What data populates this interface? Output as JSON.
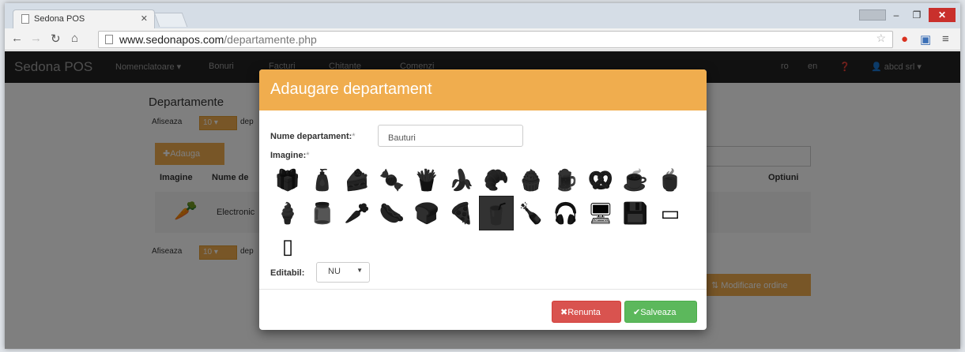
{
  "browser": {
    "tab_title": "Sedona POS",
    "url_host": "www.sedonapos.com",
    "url_path": "/departamente.php"
  },
  "navbar": {
    "brand": "Sedona POS",
    "menu": [
      "Nomenclatoare",
      "Bonuri",
      "Facturi",
      "Chitante",
      "Comenzi"
    ],
    "lang_ro": "ro",
    "lang_en": "en",
    "help_icon": "question-circle-icon",
    "user": "abcd srl"
  },
  "background_page": {
    "title": "Departamente",
    "show_label": "Afiseaza",
    "show_value": "10",
    "show_suffix": "dep",
    "add_button": "Adauga",
    "columns": [
      "Imagine",
      "Nume de",
      "Optiuni"
    ],
    "row_text": "Electronic",
    "bottom_show_label": "Afiseaza",
    "bottom_show_value": "10",
    "bottom_suffix": "dep",
    "order_button": "Modificare ordine"
  },
  "modal": {
    "title": "Adaugare departament",
    "name_label": "Nume departament:",
    "required_mark": "*",
    "name_value": "Bauturi",
    "image_label": "Imagine:",
    "icons": [
      {
        "name": "gift-box-icon",
        "glyph": "🎁"
      },
      {
        "name": "bottle-bag-icon",
        "glyph": "🧴"
      },
      {
        "name": "cake-slice-icon",
        "glyph": "🍰"
      },
      {
        "name": "candy-icon",
        "glyph": "🍬"
      },
      {
        "name": "fast-food-icon",
        "glyph": "🍟"
      },
      {
        "name": "banana-icon",
        "glyph": "🍌"
      },
      {
        "name": "croissant-icon",
        "glyph": "🥐"
      },
      {
        "name": "cupcake-icon",
        "glyph": "🧁"
      },
      {
        "name": "beer-mug-icon",
        "glyph": "🍺"
      },
      {
        "name": "pastry-icon",
        "glyph": "🥨"
      },
      {
        "name": "coffee-cup-icon",
        "glyph": "☕"
      },
      {
        "name": "tea-cup-icon",
        "glyph": "🍵"
      },
      {
        "name": "ice-cream-icon",
        "glyph": "🍦"
      },
      {
        "name": "jar-icon",
        "glyph": "🫙"
      },
      {
        "name": "carrot-icon",
        "glyph": "🥕"
      },
      {
        "name": "sausage-icon",
        "glyph": "🌭"
      },
      {
        "name": "bread-icon",
        "glyph": "🍞"
      },
      {
        "name": "pizza-icon",
        "glyph": "🍕"
      },
      {
        "name": "drink-cup-icon",
        "glyph": "🥤"
      },
      {
        "name": "wine-bottle-icon",
        "glyph": "🍾"
      },
      {
        "name": "headphones-icon",
        "glyph": "🎧"
      },
      {
        "name": "monitor-icon",
        "glyph": "🖥"
      },
      {
        "name": "disk-drive-icon",
        "glyph": "💾"
      },
      {
        "name": "tablet-icon",
        "glyph": "▭"
      },
      {
        "name": "smartphone-icon",
        "glyph": "▯"
      }
    ],
    "selected_icon_index": 18,
    "editabil_label": "Editabil:",
    "editabil_value": "NU",
    "cancel_button": "Renunta",
    "save_button": "Salveaza"
  },
  "colors": {
    "accent": "#f0ad4e",
    "cancel": "#d9534f",
    "save": "#5cb85c",
    "navbar": "#222222"
  }
}
